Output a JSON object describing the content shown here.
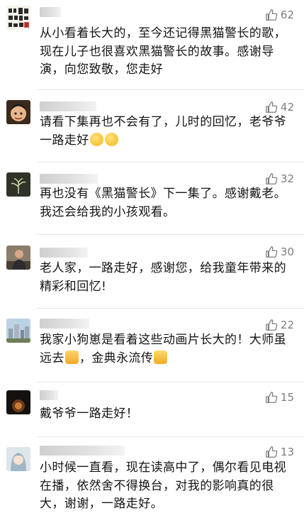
{
  "comments": [
    {
      "likes": "62",
      "text": "从小看着长大的，至今还记得黑猫警长的歌，现在儿子也很喜欢黑猫警长的故事。感谢导演，向您致敬，您走好",
      "avatar": "calligraphy-avatar"
    },
    {
      "likes": "42",
      "text": "请看下集再也不会有了，儿时的回忆，老爷爷一路走好",
      "emoji": [
        "crying-face",
        "crying-face"
      ],
      "avatar": "cartoon-avatar"
    },
    {
      "likes": "32",
      "text": "再也没有《黑猫警长》下一集了。感谢戴老。我还会给我的小孩观看。",
      "avatar": "plant-avatar"
    },
    {
      "likes": "30",
      "text": "老人家，一路走好，感谢您，给我童年带来的精彩和回忆!",
      "avatar": "person-avatar"
    },
    {
      "likes": "22",
      "text": "我家小狗崽是看着这些动画片长大的！大师虽远去",
      "text2": "，金典永流传",
      "avatar": "city-avatar",
      "emoji": [
        "folded-hands",
        "thumbs-up"
      ]
    },
    {
      "likes": "15",
      "text": "戴爷爷一路走好！",
      "avatar": "dark-avatar"
    },
    {
      "likes": "13",
      "text": "小时候一直看，现在读高中了，偶尔看见电视在播，依然舍不得换台，对我的影响真的很大，谢谢，一路走好。",
      "avatar": "anime-avatar"
    }
  ],
  "colors": {
    "text": "#141414",
    "meta": "#7d7d7d",
    "divider": "#e6e6e6"
  }
}
